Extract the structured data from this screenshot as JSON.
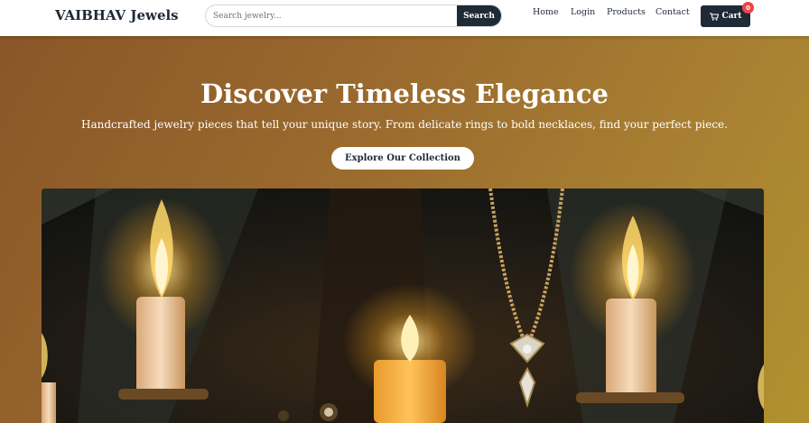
{
  "header": {
    "logo": "VAIBHAV Jewels",
    "search": {
      "placeholder": "Search jewelry...",
      "button_label": "Search"
    },
    "nav": {
      "home": "Home",
      "login": "Login",
      "products": "Products",
      "contact": "Contact"
    },
    "cart": {
      "label": "Cart",
      "count": "0",
      "icon": "cart-icon"
    }
  },
  "hero": {
    "title": "Discover Timeless Elegance",
    "subtitle": "Handcrafted jewelry pieces that tell your unique story. From delicate rings to bold necklaces, find your perfect piece.",
    "cta_label": "Explore Our Collection"
  },
  "colors": {
    "accent_dark": "#1f2a37",
    "badge": "#ef4444",
    "hero_gradient_start": "#8a5627",
    "hero_gradient_end": "#b0912f"
  }
}
